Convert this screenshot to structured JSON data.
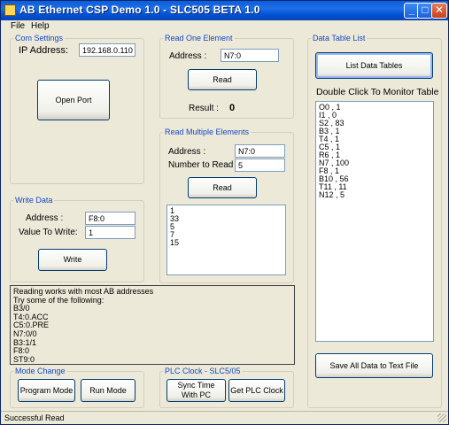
{
  "window": {
    "title": "AB Ethernet CSP Demo 1.0 - SLC505 BETA 1.0",
    "controls": {
      "minimize": "_",
      "maximize": "□",
      "close": "✕"
    }
  },
  "menu": {
    "file": "File",
    "help": "Help"
  },
  "com_settings": {
    "legend": "Com Settings",
    "ip_label": "IP Address:",
    "ip_value": "192.168.0.110",
    "open_port": "Open Port"
  },
  "read_one": {
    "legend": "Read One Element",
    "address_label": "Address :",
    "address_value": "N7:0",
    "read_button": "Read",
    "result_label": "Result :",
    "result_value": "0"
  },
  "read_multiple": {
    "legend": "Read Multiple Elements",
    "address_label": "Address :",
    "address_value": "N7:0",
    "number_label": "Number to Read :",
    "number_value": "5",
    "read_button": "Read",
    "results": [
      "1",
      "33",
      "5",
      "7",
      "15"
    ]
  },
  "write_data": {
    "legend": "Write Data",
    "address_label": "Address :",
    "address_value": "F8:0",
    "value_label": "Value To Write:",
    "value_value": "1",
    "write_button": "Write"
  },
  "info": {
    "lines": [
      "Reading works with most AB addresses",
      "Try some of the following:",
      "B3/0",
      "T4:0.ACC",
      "C5:0.PRE",
      "N7:0/0",
      "B3:1/1",
      "F8:0",
      "ST9:0"
    ]
  },
  "mode_change": {
    "legend": "Mode Change",
    "program_mode": "Program Mode",
    "run_mode": "Run Mode"
  },
  "plc_clock": {
    "legend": "PLC Clock - SLC5/05",
    "sync_time": "Sync Time With PC",
    "get_clock": "Get PLC Clock"
  },
  "data_table": {
    "legend": "Data Table List",
    "list_button": "List Data Tables",
    "monitor_label": "Double Click To Monitor Table",
    "tables": [
      "O0 , 1",
      "I1 , 0",
      "S2 , 83",
      "B3 , 1",
      "T4 , 1",
      "C5 , 1",
      "R6 , 1",
      "N7 , 100",
      "F8 , 1",
      "B10 , 56",
      "T11 , 11",
      "N12 , 5"
    ],
    "save_button": "Save All Data to Text File"
  },
  "status": {
    "text": "Successful Read"
  }
}
